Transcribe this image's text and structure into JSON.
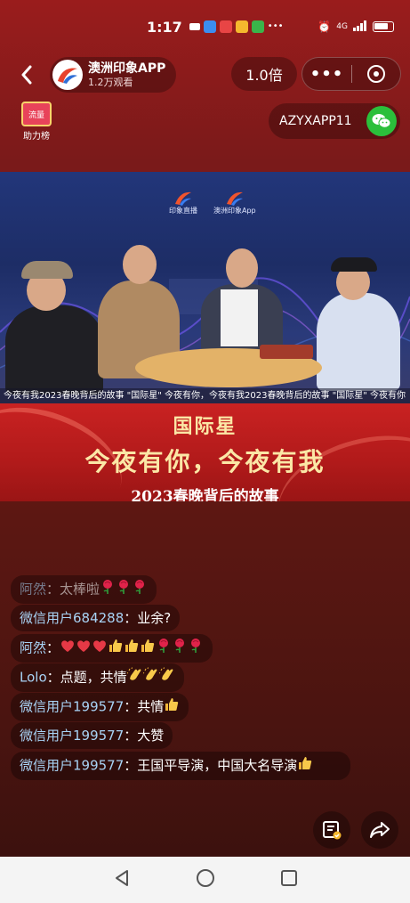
{
  "status_bar": {
    "time": "1:17",
    "network": "4G",
    "icon_colors": [
      "#3b8df0",
      "#e84545",
      "#f5b82e",
      "#3ab54a"
    ]
  },
  "header": {
    "host_name": "澳洲印象APP",
    "host_views": "1.2万观看",
    "speed": "1.0倍",
    "more_icon": "•••"
  },
  "rank_badge": {
    "box_text": "流量",
    "label": "助力榜"
  },
  "wechat": {
    "id": "AZYXAPP11"
  },
  "video": {
    "logo_left": "印象直播",
    "logo_right": "澳洲印象App",
    "ticker": "今夜有我2023春晚背后的故事 \"国际星\" 今夜有你，今夜有我2023春晚背后的故事 \"国际星\" 今夜有你",
    "banner_line1": "国际星",
    "banner_line2": "今夜有你，今夜有我",
    "banner_line3": "2023春晚背后的故事"
  },
  "comments": [
    {
      "user": "阿然",
      "sep": "：",
      "text": "太棒啦",
      "emojis": [
        "rose",
        "rose",
        "rose"
      ],
      "faded": true
    },
    {
      "user": "微信用户684288",
      "sep": "：",
      "text": "业余?",
      "emojis": [],
      "faded": false
    },
    {
      "user": "阿然",
      "sep": "：",
      "text": "",
      "emojis": [
        "heart",
        "heart",
        "heart",
        "thumb",
        "thumb",
        "thumb",
        "rose",
        "rose",
        "rose"
      ],
      "faded": false
    },
    {
      "user": "Lolo",
      "sep": "：",
      "text": "点题，共情",
      "emojis": [
        "clap",
        "clap",
        "clap"
      ],
      "faded": false
    },
    {
      "user": "微信用户199577",
      "sep": "：",
      "text": "共情",
      "emojis": [
        "thumb"
      ],
      "faded": false
    },
    {
      "user": "微信用户199577",
      "sep": "：",
      "text": "大赞",
      "emojis": [],
      "faded": false
    },
    {
      "user": "微信用户199577",
      "sep": "：",
      "text": "王国平导演，中国大名导演",
      "emojis": [
        "thumb"
      ],
      "faded": false
    }
  ],
  "actions": {
    "left_icon": "checklist-icon",
    "right_icon": "share-icon"
  },
  "colors": {
    "username": "#a8d3f5",
    "wechat_green": "#2bbf3b",
    "banner_gold": "#fbe7a6"
  }
}
